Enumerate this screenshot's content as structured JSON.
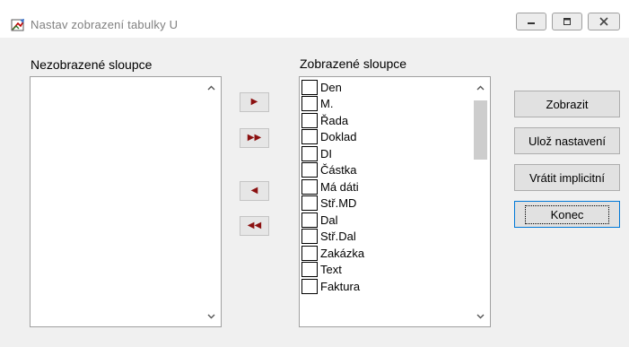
{
  "window": {
    "title": "Nastav zobrazení tabulky U"
  },
  "hidden_columns": {
    "label": "Nezobrazené sloupce",
    "items": []
  },
  "shown_columns": {
    "label": "Zobrazené sloupce",
    "items": [
      "Den",
      "M.",
      "Řada",
      "Doklad",
      "DI",
      "Částka",
      "Má dáti",
      "Stř.MD",
      "Dal",
      "Stř.Dal",
      "Zakázka",
      "Text",
      "Faktura"
    ]
  },
  "move_buttons": {
    "move_one_right": "▶",
    "move_all_right": "▶▶",
    "move_one_left": "◀",
    "move_all_left": "◀◀"
  },
  "actions": {
    "show": "Zobrazit",
    "save": "Ulož nastavení",
    "restore_default": "Vrátit implicitní",
    "close": "Konec"
  },
  "colors": {
    "arrow": "#8b1010",
    "focus_border": "#0078d7"
  }
}
